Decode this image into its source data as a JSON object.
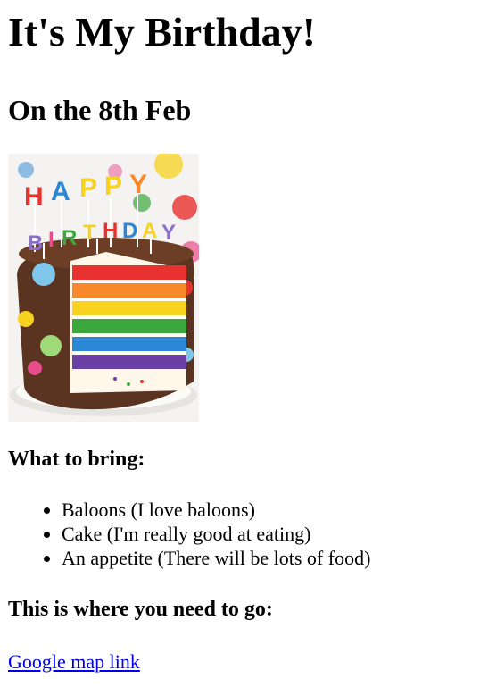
{
  "heading": "It's My Birthday!",
  "date_heading": "On the 8th Feb",
  "cake_image": {
    "letters_top": [
      "H",
      "A",
      "P",
      "P",
      "Y"
    ],
    "letters_bottom": [
      "B",
      "I",
      "R",
      "T",
      "H",
      "D",
      "A",
      "Y"
    ],
    "layer_colors": [
      "#e8322f",
      "#f7892b",
      "#f7d21e",
      "#3aa83c",
      "#2b86d6",
      "#6a3fa6"
    ]
  },
  "bring": {
    "heading": "What to bring:",
    "items": [
      "Baloons (I love baloons)",
      "Cake (I'm really good at eating)",
      "An appetite (There will be lots of food)"
    ]
  },
  "directions": {
    "heading": "This is where you need to go:",
    "link_text": "Google map link",
    "link_color": "#0000ee"
  }
}
